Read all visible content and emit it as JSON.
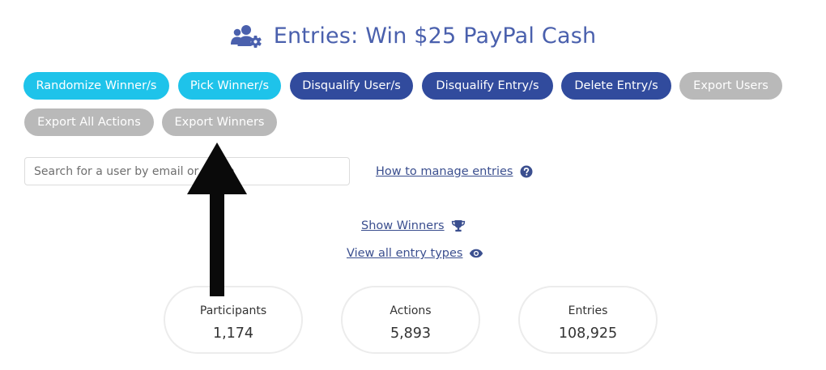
{
  "header": {
    "title": "Entries: Win $25 PayPal Cash",
    "icon": "users-gear-icon"
  },
  "actions": {
    "randomize": "Randomize Winner/s",
    "pick": "Pick Winner/s",
    "disqualify_users": "Disqualify User/s",
    "disqualify_entries": "Disqualify Entry/s",
    "delete_entries": "Delete Entry/s",
    "export_users": "Export Users",
    "export_all_actions": "Export All Actions",
    "export_winners": "Export Winners"
  },
  "search": {
    "placeholder": "Search for a user by email or name",
    "value": ""
  },
  "links": {
    "manage": "How to manage entries",
    "show_winners": "Show Winners",
    "view_types": "View all entry types"
  },
  "stats": {
    "participants": {
      "label": "Participants",
      "value": "1,174"
    },
    "actions": {
      "label": "Actions",
      "value": "5,893"
    },
    "entries": {
      "label": "Entries",
      "value": "108,925"
    }
  },
  "colors": {
    "primary_cyan": "#1ec3ea",
    "primary_navy": "#314b9d",
    "disabled_gray": "#b9b9b9",
    "title_blue": "#4a60ad",
    "link": "#3b4f8f"
  }
}
